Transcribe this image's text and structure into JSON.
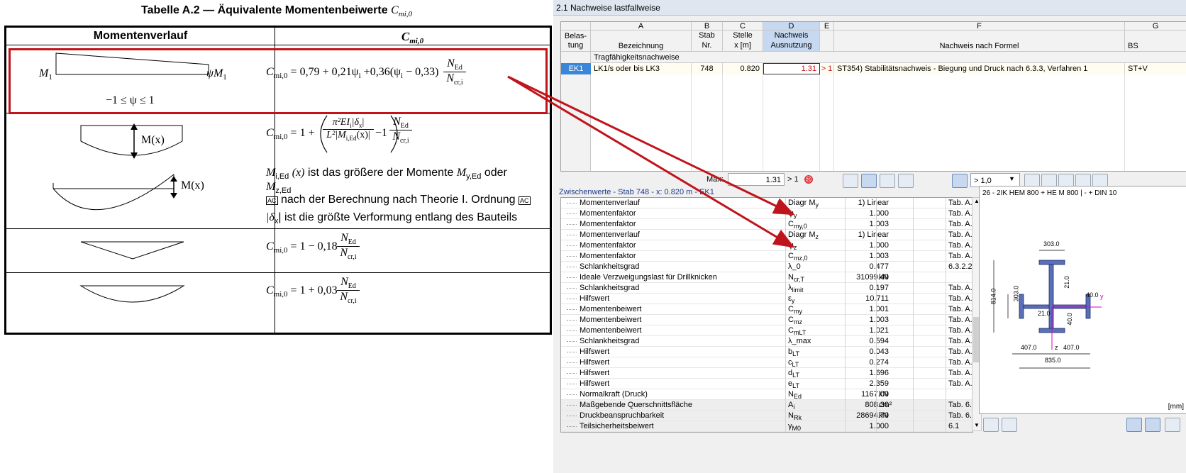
{
  "doc": {
    "title_text": "Tabelle A.2 — Äquivalente Momentenbeiwerte",
    "title_symbol": "C",
    "title_sub": "mi,0",
    "col1_header": "Momentenverlauf",
    "col2_header_symbol": "C",
    "col2_header_sub": "mi,0",
    "row1": {
      "left_label": "M",
      "left_sub": "1",
      "right_label": "ψM",
      "right_sub": "1",
      "range": "−1 ≤ ψ ≤ 1",
      "formula": "= 0,79 + 0,21ψ",
      "formula_b": " +0,36(ψ",
      "formula_c": " − 0,33)",
      "num": "N",
      "num_sub": "Ed",
      "den": "N",
      "den_sub": "cr,i"
    },
    "row2": {
      "mx_label": "M(x)",
      "mx_label2": "M(x)",
      "text1": "ist das größere der Momente",
      "text1_a": "M",
      "text1_a_sub": "i,Ed",
      "text1_x": "(x)",
      "text1_b": "M",
      "text1_b_sub": "y,Ed",
      "text1_oder": "oder",
      "text2_m": "M",
      "text2_sub": "z,Ed",
      "text3": "nach der Berechnung nach Theorie I. Ordnung",
      "ac_badge": "AC",
      "text4_sym": "|δ",
      "text4_sub": "x",
      "text4_end": "| ist die größte Verformung entlang des Bauteils",
      "pi_term": "π²EI",
      "pi_sub": "i",
      "delta": "|δ",
      "delta_sub": "x",
      "delta_end": "|",
      "l2": "L²|M",
      "l2_sub": "i,Ed",
      "l2_end": "(x)|",
      "minus1": "−1",
      "one_plus": "= 1 +"
    },
    "row3": {
      "formula": "= 1 − 0,18"
    },
    "row4": {
      "formula": "= 1 + 0,03"
    }
  },
  "app": {
    "window_title": "2.1 Nachweise lastfallweise",
    "grid": {
      "col_letters": [
        "A",
        "B",
        "C",
        "D",
        "E",
        "F",
        "G"
      ],
      "h_belastung": "Belas-\ntung",
      "h_a": "Bezeichnung",
      "h_b1": "Stab",
      "h_b2": "Nr.",
      "h_c1": "Stelle",
      "h_c2": "x [m]",
      "h_d1": "Nachweis",
      "h_d2": "Ausnutzung",
      "h_f": "Nachweis nach Formel",
      "h_g": "BS",
      "section": "Tragfähigkeitsnachweise",
      "row": {
        "ek": "EK1",
        "bez": "LK1/s oder bis LK3",
        "stab": "748",
        "stelle": "0.820",
        "ausn": "1.31",
        "flag": "> 1",
        "formel": "ST354) Stabilitätsnachweis - Biegung und Druck nach 6.3.3, Verfahren 1",
        "bs": "ST+V"
      }
    },
    "max_label": "Max:",
    "max_value": "1.31",
    "max_flag": "> 1",
    "filter_value": "> 1,0",
    "zw_title": "Zwischenwerte - Stab 748 - x: 0.820 m - EK1",
    "zw_rows": [
      {
        "name": "Momentenverlauf",
        "sym": "Diagr M",
        "sym_sub": "y",
        "val": "1) Linear",
        "unit": "",
        "ref": "Tab. A.2"
      },
      {
        "name": "Momentenfaktor",
        "sym": "ψ",
        "sym_sub": "y",
        "val": "1.000",
        "unit": "",
        "ref": "Tab. A.2"
      },
      {
        "name": "Momentenfaktor",
        "sym": "C",
        "sym_sub": "my,0",
        "val": "1.003",
        "unit": "",
        "ref": "Tab. A.2"
      },
      {
        "name": "Momentenverlauf",
        "sym": "Diagr M",
        "sym_sub": "z",
        "val": "1) Linear",
        "unit": "",
        "ref": "Tab. A.2"
      },
      {
        "name": "Momentenfaktor",
        "sym": "ψ",
        "sym_sub": "z",
        "val": "1.000",
        "unit": "",
        "ref": "Tab. A.2"
      },
      {
        "name": "Momentenfaktor",
        "sym": "C",
        "sym_sub": "mz,0",
        "val": "1.003",
        "unit": "",
        "ref": "Tab. A.2"
      },
      {
        "name": "Schlankheitsgrad",
        "sym": "λ_0",
        "sym_sub": "",
        "val": "0.477",
        "unit": "",
        "ref": "6.3.2.2(1)"
      },
      {
        "name": "Ideale Verzweigungslast für Drillknicken",
        "sym": "N",
        "sym_sub": "cr,T",
        "val": "31099.40",
        "unit": "kN",
        "ref": ""
      },
      {
        "name": "Schlankheitsgrad",
        "sym": "λ",
        "sym_sub": "limit",
        "val": "0.197",
        "unit": "",
        "ref": "Tab. A.1"
      },
      {
        "name": "Hilfswert",
        "sym": "ε",
        "sym_sub": "y",
        "val": "10.711",
        "unit": "",
        "ref": "Tab. A.1"
      },
      {
        "name": "Momentenbeiwert",
        "sym": "C",
        "sym_sub": "my",
        "val": "1.001",
        "unit": "",
        "ref": "Tab. A.2"
      },
      {
        "name": "Momentenbeiwert",
        "sym": "C",
        "sym_sub": "mz",
        "val": "1.003",
        "unit": "",
        "ref": "Tab. A.2"
      },
      {
        "name": "Momentenbeiwert",
        "sym": "C",
        "sym_sub": "mLT",
        "val": "1.021",
        "unit": "",
        "ref": "Tab. A.2"
      },
      {
        "name": "Schlankheitsgrad",
        "sym": "λ_max",
        "sym_sub": "",
        "val": "0.594",
        "unit": "",
        "ref": "Tab. A.1"
      },
      {
        "name": "Hilfswert",
        "sym": "b",
        "sym_sub": "LT",
        "val": "0.043",
        "unit": "",
        "ref": "Tab. A.1"
      },
      {
        "name": "Hilfswert",
        "sym": "c",
        "sym_sub": "LT",
        "val": "0.274",
        "unit": "",
        "ref": "Tab. A.1"
      },
      {
        "name": "Hilfswert",
        "sym": "d",
        "sym_sub": "LT",
        "val": "1.696",
        "unit": "",
        "ref": "Tab. A.1"
      },
      {
        "name": "Hilfswert",
        "sym": "e",
        "sym_sub": "LT",
        "val": "2.359",
        "unit": "",
        "ref": "Tab. A.1"
      },
      {
        "name": "Normalkraft (Druck)",
        "sym": "N",
        "sym_sub": "Ed",
        "val": "1167.00",
        "unit": "kN",
        "ref": ""
      },
      {
        "name": "Maßgebende Querschnittsfläche",
        "sym": "A",
        "sym_sub": "i",
        "val": "808.30",
        "unit": "cm²",
        "ref": "Tab. 6.7"
      },
      {
        "name": "Druckbeanspruchbarkeit",
        "sym": "N",
        "sym_sub": "Rk",
        "val": "28694.70",
        "unit": "kN",
        "ref": "Tab. 6.7"
      },
      {
        "name": "Teilsicherheitsbeiwert",
        "sym": "γ",
        "sym_sub": "M0",
        "val": "1.000",
        "unit": "",
        "ref": "6.1"
      }
    ],
    "cs_title": "26 - 2IK HEM 800 + HE M 800 | - + DIN 10",
    "cs_dims": {
      "top": "303.0",
      "left_h": "814.0",
      "left_small": "303.0",
      "web": "21.0",
      "right": "40.0",
      "web2": "21.0",
      "bot_small": "40.0",
      "w1": "407.0",
      "w2": "407.0",
      "total": "835.0",
      "y": "y",
      "z": "z"
    },
    "unit_label": "[mm]",
    "colors": {
      "red": "#c0141c",
      "accent": "#c6d9f0",
      "title_bg": "#dfe6ef"
    }
  }
}
